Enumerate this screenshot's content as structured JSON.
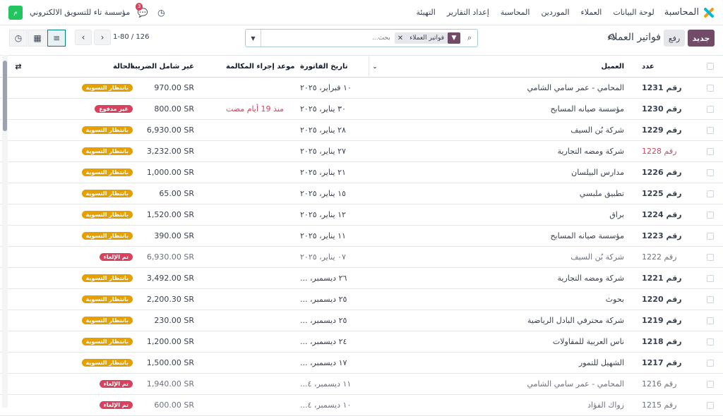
{
  "topbar": {
    "app_name": "المحاسبة",
    "brand_colors": [
      "#f59e0b",
      "#06b6d4",
      "#d9425e"
    ],
    "menu": [
      "لوحة البيانات",
      "العملاء",
      "الموردين",
      "المحاسبة",
      "إعداد التقارير",
      "التهيئة"
    ],
    "company": "مؤسسة تاء للتسويق الالكتروني",
    "avatar_letter": "م",
    "chat_badge": "3"
  },
  "control": {
    "new_label": "جديد",
    "upload_label": "رفع",
    "title": "فواتير العملاء",
    "search": {
      "facet_label": "فواتير العملاء",
      "placeholder": "بحث..."
    },
    "pager": "1-80 / 126"
  },
  "table": {
    "headers": {
      "number": "عدد",
      "customer": "العميل",
      "invoice_date": "تاريخ الفاتورة",
      "call_date": "موعد إجراء المكالمة",
      "untaxed": "غير شامل الضريبة",
      "status": "الحالة"
    },
    "rows": [
      {
        "number": "رقم 1231",
        "customer": "المحامي - عمر سامي الشامي",
        "date": "١٠ فبراير، ٢٠٢٥",
        "due": "",
        "amount": "970.00 SR",
        "status": "بانتظار التسوية",
        "status_color": "#e5a000",
        "style": "normal"
      },
      {
        "number": "رقم 1230",
        "customer": "مؤسسة صيانه المسابح",
        "date": "٣٠ يناير، ٢٠٢٥",
        "due": "منذ 19 أيام مضت",
        "amount": "800.00 SR",
        "status": "غير مدفوع",
        "status_color": "#d9425e",
        "style": "normal"
      },
      {
        "number": "رقم 1229",
        "customer": "شركة بُن السيف",
        "date": "٢٨ يناير، ٢٠٢٥",
        "due": "",
        "amount": "6,930.00 SR",
        "status": "بانتظار التسوية",
        "status_color": "#e5a000",
        "style": "normal"
      },
      {
        "number": "رقم 1228",
        "customer": "شركة ومضه التجارية",
        "date": "٢٧ يناير، ٢٠٢٥",
        "due": "",
        "amount": "3,232.00 SR",
        "status": "بانتظار التسوية",
        "status_color": "#e5a000",
        "style": "red"
      },
      {
        "number": "رقم 1226",
        "customer": "مدارس البيلسان",
        "date": "٢١ يناير، ٢٠٢٥",
        "due": "",
        "amount": "1,000.00 SR",
        "status": "بانتظار التسوية",
        "status_color": "#e5a000",
        "style": "normal"
      },
      {
        "number": "رقم 1225",
        "customer": "تطبيق ملبسي",
        "date": "١٥ يناير، ٢٠٢٥",
        "due": "",
        "amount": "65.00 SR",
        "status": "بانتظار التسوية",
        "status_color": "#e5a000",
        "style": "normal"
      },
      {
        "number": "رقم 1224",
        "customer": "براق",
        "date": "١٢ يناير، ٢٠٢٥",
        "due": "",
        "amount": "1,520.00 SR",
        "status": "بانتظار التسوية",
        "status_color": "#e5a000",
        "style": "normal"
      },
      {
        "number": "رقم 1223",
        "customer": "مؤسسة صيانه المسابح",
        "date": "١١ يناير، ٢٠٢٥",
        "due": "",
        "amount": "390.00 SR",
        "status": "بانتظار التسوية",
        "status_color": "#e5a000",
        "style": "normal"
      },
      {
        "number": "رقم 1222",
        "customer": "شركة بُن السيف",
        "date": "٠٧ يناير، ٢٠٢٥",
        "due": "",
        "amount": "6,930.00 SR",
        "status": "تم الإلغاء",
        "status_color": "#d9425e",
        "style": "muted"
      },
      {
        "number": "رقم 1221",
        "customer": "شركة ومضه التجارية",
        "date": "٢٦ ديسمبر، ...",
        "due": "",
        "amount": "3,492.00 SR",
        "status": "بانتظار التسوية",
        "status_color": "#e5a000",
        "style": "normal"
      },
      {
        "number": "رقم 1220",
        "customer": "بحوث",
        "date": "٢٥ ديسمبر، ...",
        "due": "",
        "amount": "2,200.30 SR",
        "status": "بانتظار التسوية",
        "status_color": "#e5a000",
        "style": "normal"
      },
      {
        "number": "رقم 1219",
        "customer": "شركة محترفي البادل الرياضية",
        "date": "٢٥ ديسمبر، ...",
        "due": "",
        "amount": "230.00 SR",
        "status": "بانتظار التسوية",
        "status_color": "#e5a000",
        "style": "normal"
      },
      {
        "number": "رقم 1218",
        "customer": "ناس العربية للمقاولات",
        "date": "٢٤ ديسمبر، ...",
        "due": "",
        "amount": "1,200.00 SR",
        "status": "بانتظار التسوية",
        "status_color": "#e5a000",
        "style": "normal"
      },
      {
        "number": "رقم 1217",
        "customer": "الشهيل للتمور",
        "date": "١٧ ديسمبر، ...",
        "due": "",
        "amount": "1,500.00 SR",
        "status": "بانتظار التسوية",
        "status_color": "#e5a000",
        "style": "normal"
      },
      {
        "number": "رقم 1216",
        "customer": "المحامي - عمر سامي الشامي",
        "date": "١١ ديسمبر، ٤...",
        "due": "",
        "amount": "1,940.00 SR",
        "status": "تم الإلغاء",
        "status_color": "#d9425e",
        "style": "muted"
      },
      {
        "number": "رقم 1215",
        "customer": "زواك الفؤاد",
        "date": "١٠ ديسمبر، ٤...",
        "due": "",
        "amount": "600.00 SR",
        "status": "تم الإلغاء",
        "status_color": "#d9425e",
        "style": "muted"
      }
    ]
  }
}
